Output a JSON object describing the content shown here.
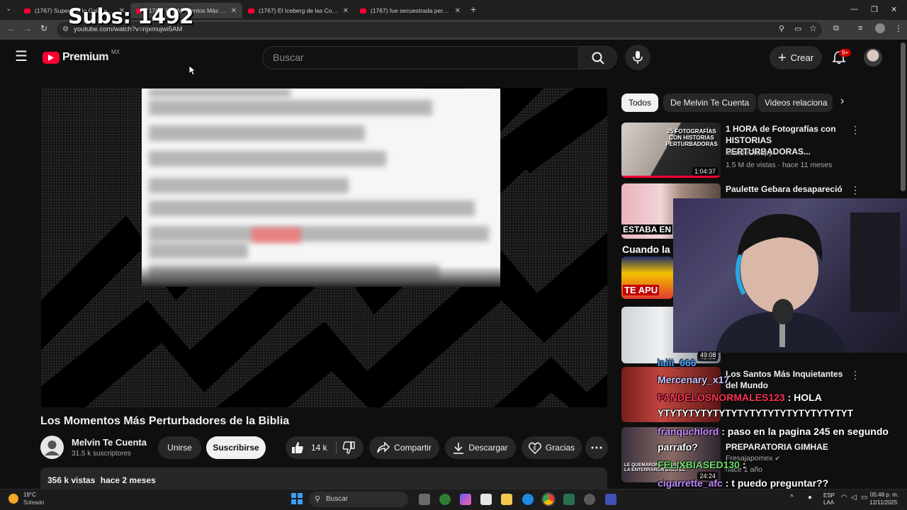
{
  "overlay": {
    "subs_counter": "Subs: 1492"
  },
  "browser": {
    "tabs": [
      {
        "title": "(1767) Super Mario Galaxy La..."
      },
      {
        "title": "(1767) Los Momentos Más Pert..."
      },
      {
        "title": "(1767) El Iceberg de las Cosas..."
      },
      {
        "title": "(1767) fue secuestrada pero la..."
      }
    ],
    "url": "youtube.com/watch?v=njxmujwi5AM"
  },
  "header": {
    "logo_text": "Premium",
    "logo_region": "MX",
    "search_placeholder": "Buscar",
    "create_label": "Crear",
    "notifications_badge": "9+"
  },
  "video": {
    "title": "Los Momentos Más Perturbadores de la Biblia",
    "channel_name": "Melvin Te Cuenta",
    "channel_subs": "31.5 k suscriptores",
    "join_label": "Unirse",
    "subscribe_label": "Suscribirse",
    "likes": "14 k",
    "share_label": "Compartir",
    "download_label": "Descargar",
    "thanks_label": "Gracias",
    "views": "356 k vistas",
    "uploaded": "hace 2 meses"
  },
  "sidebar": {
    "chips": [
      "Todos",
      "De Melvin Te Cuenta",
      "Videos relaciona"
    ],
    "recommendations": [
      {
        "title": "1 HORA de Fotografías con HISTORIAS PERTURBADORAS...",
        "channel": "MundoCreepy",
        "meta": "1.5 M de vistas · hace 11 meses",
        "duration": "1:04:37",
        "thumb_text": "25 FOTOGRAFÍAS CON HISTORIAS PERTURBADORAS"
      },
      {
        "title": "Paulette Gebara desapareció",
        "channel": "",
        "meta": "",
        "duration": "",
        "thumb_text": "ESTABA EN"
      },
      {
        "title": "",
        "channel": "",
        "meta": "",
        "duration": "",
        "thumb_text": "TE APU"
      },
      {
        "title": "",
        "channel": "",
        "meta": "",
        "duration": "49:08",
        "thumb_text": ""
      },
      {
        "title": "Los Santos Más Inquietantes del Mundo",
        "channel": "",
        "meta": "",
        "duration": "",
        "thumb_text": ""
      },
      {
        "title": "PREPARATORIA GIMHAE",
        "channel": "Fresajapomex",
        "meta": "hace 1 año",
        "duration": "24:24",
        "thumb_text": "LE QUEMARON EL ROSTRO Y LA ENTERRARON BAJO EL"
      }
    ],
    "cuando_text": "Cuando la"
  },
  "chat": [
    {
      "user": "lalii_666",
      "msg": "",
      "color": "#4da3ff"
    },
    {
      "user": "Mercenary_x17",
      "msg": "",
      "color": "#c7c7ff"
    },
    {
      "user": "FANDELOSNORMALES123",
      "msg": ": HOLA",
      "color": "#ff3355"
    },
    {
      "user": "",
      "msg": "YTYTYTYTYTYTYTYTYTYTYTYTYTYTYTYT",
      "color": "#ffffff"
    },
    {
      "user": "franquchlord",
      "msg": ": paso en la pagina 245 en segundo",
      "color": "#c28bff"
    },
    {
      "user": "",
      "msg": "parrafo?",
      "color": "#ffffff"
    },
    {
      "user": "FELIXBIASED130",
      "msg": ":",
      "color": "#6fe06f"
    },
    {
      "user": "cigarrette_afc",
      "msg": ": t puedo preguntar??",
      "color": "#c28bff"
    }
  ],
  "taskbar": {
    "weather_temp": "19°C",
    "weather_desc": "Soleado",
    "search_label": "Buscar",
    "lang": "ESP",
    "lang_sub": "LAA",
    "time": "05:48 p. m.",
    "date": "12/11/2025"
  },
  "colors": {
    "youtube_red": "#ff0033",
    "background": "#0f0f0f",
    "chip_bg": "#272727"
  }
}
